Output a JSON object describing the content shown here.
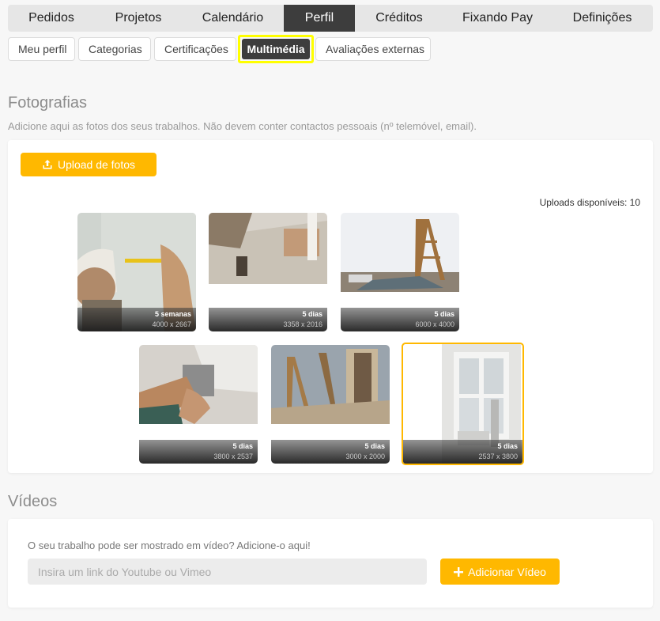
{
  "topnav": {
    "tabs": [
      {
        "label": "Pedidos",
        "active": false
      },
      {
        "label": "Projetos",
        "active": false
      },
      {
        "label": "Calendário",
        "active": false
      },
      {
        "label": "Perfil",
        "active": true
      },
      {
        "label": "Créditos",
        "active": false
      },
      {
        "label": "Fixando Pay",
        "active": false
      },
      {
        "label": "Definições",
        "active": false
      }
    ]
  },
  "subnav": {
    "items": [
      {
        "label": "Meu perfil",
        "active": false
      },
      {
        "label": "Categorias",
        "active": false
      },
      {
        "label": "Certificações",
        "active": false
      },
      {
        "label": "Multimédia",
        "active": true
      },
      {
        "label": "Avaliações externas",
        "active": false
      }
    ]
  },
  "photos_section": {
    "title": "Fotografias",
    "description": "Adicione aqui as fotos dos seus trabalhos. Não devem conter contactos pessoais (nº telemóvel, email).",
    "upload_button": "Upload de fotos",
    "upload_icon": "upload-icon",
    "uploads_available": "Uploads disponíveis: 10",
    "photos": [
      {
        "age": "5 semanas",
        "dimensions": "4000 x 2667",
        "subject": "worker-measuring-wall"
      },
      {
        "age": "5 dias",
        "dimensions": "3358 x 2016",
        "subject": "floor-installation"
      },
      {
        "age": "5 dias",
        "dimensions": "6000 x 4000",
        "subject": "ladder-empty-room"
      },
      {
        "age": "5 dias",
        "dimensions": "3800 x 2537",
        "subject": "drilling-bracket"
      },
      {
        "age": "5 dias",
        "dimensions": "3000 x 2000",
        "subject": "renovation-ladders"
      },
      {
        "age": "5 dias",
        "dimensions": "2537 x 3800",
        "subject": "window-room",
        "selected": true
      }
    ]
  },
  "videos_section": {
    "title": "Vídeos",
    "prompt": "O seu trabalho pode ser mostrado em vídeo? Adicione-o aqui!",
    "input_placeholder": "Insira um link do Youtube ou Vimeo",
    "input_value": "",
    "add_button": "Adicionar Vídeo",
    "add_icon": "plus-icon"
  },
  "colors": {
    "accent": "#ffb800",
    "active_tab": "#3d3d3d",
    "highlight": "#ffff00"
  }
}
